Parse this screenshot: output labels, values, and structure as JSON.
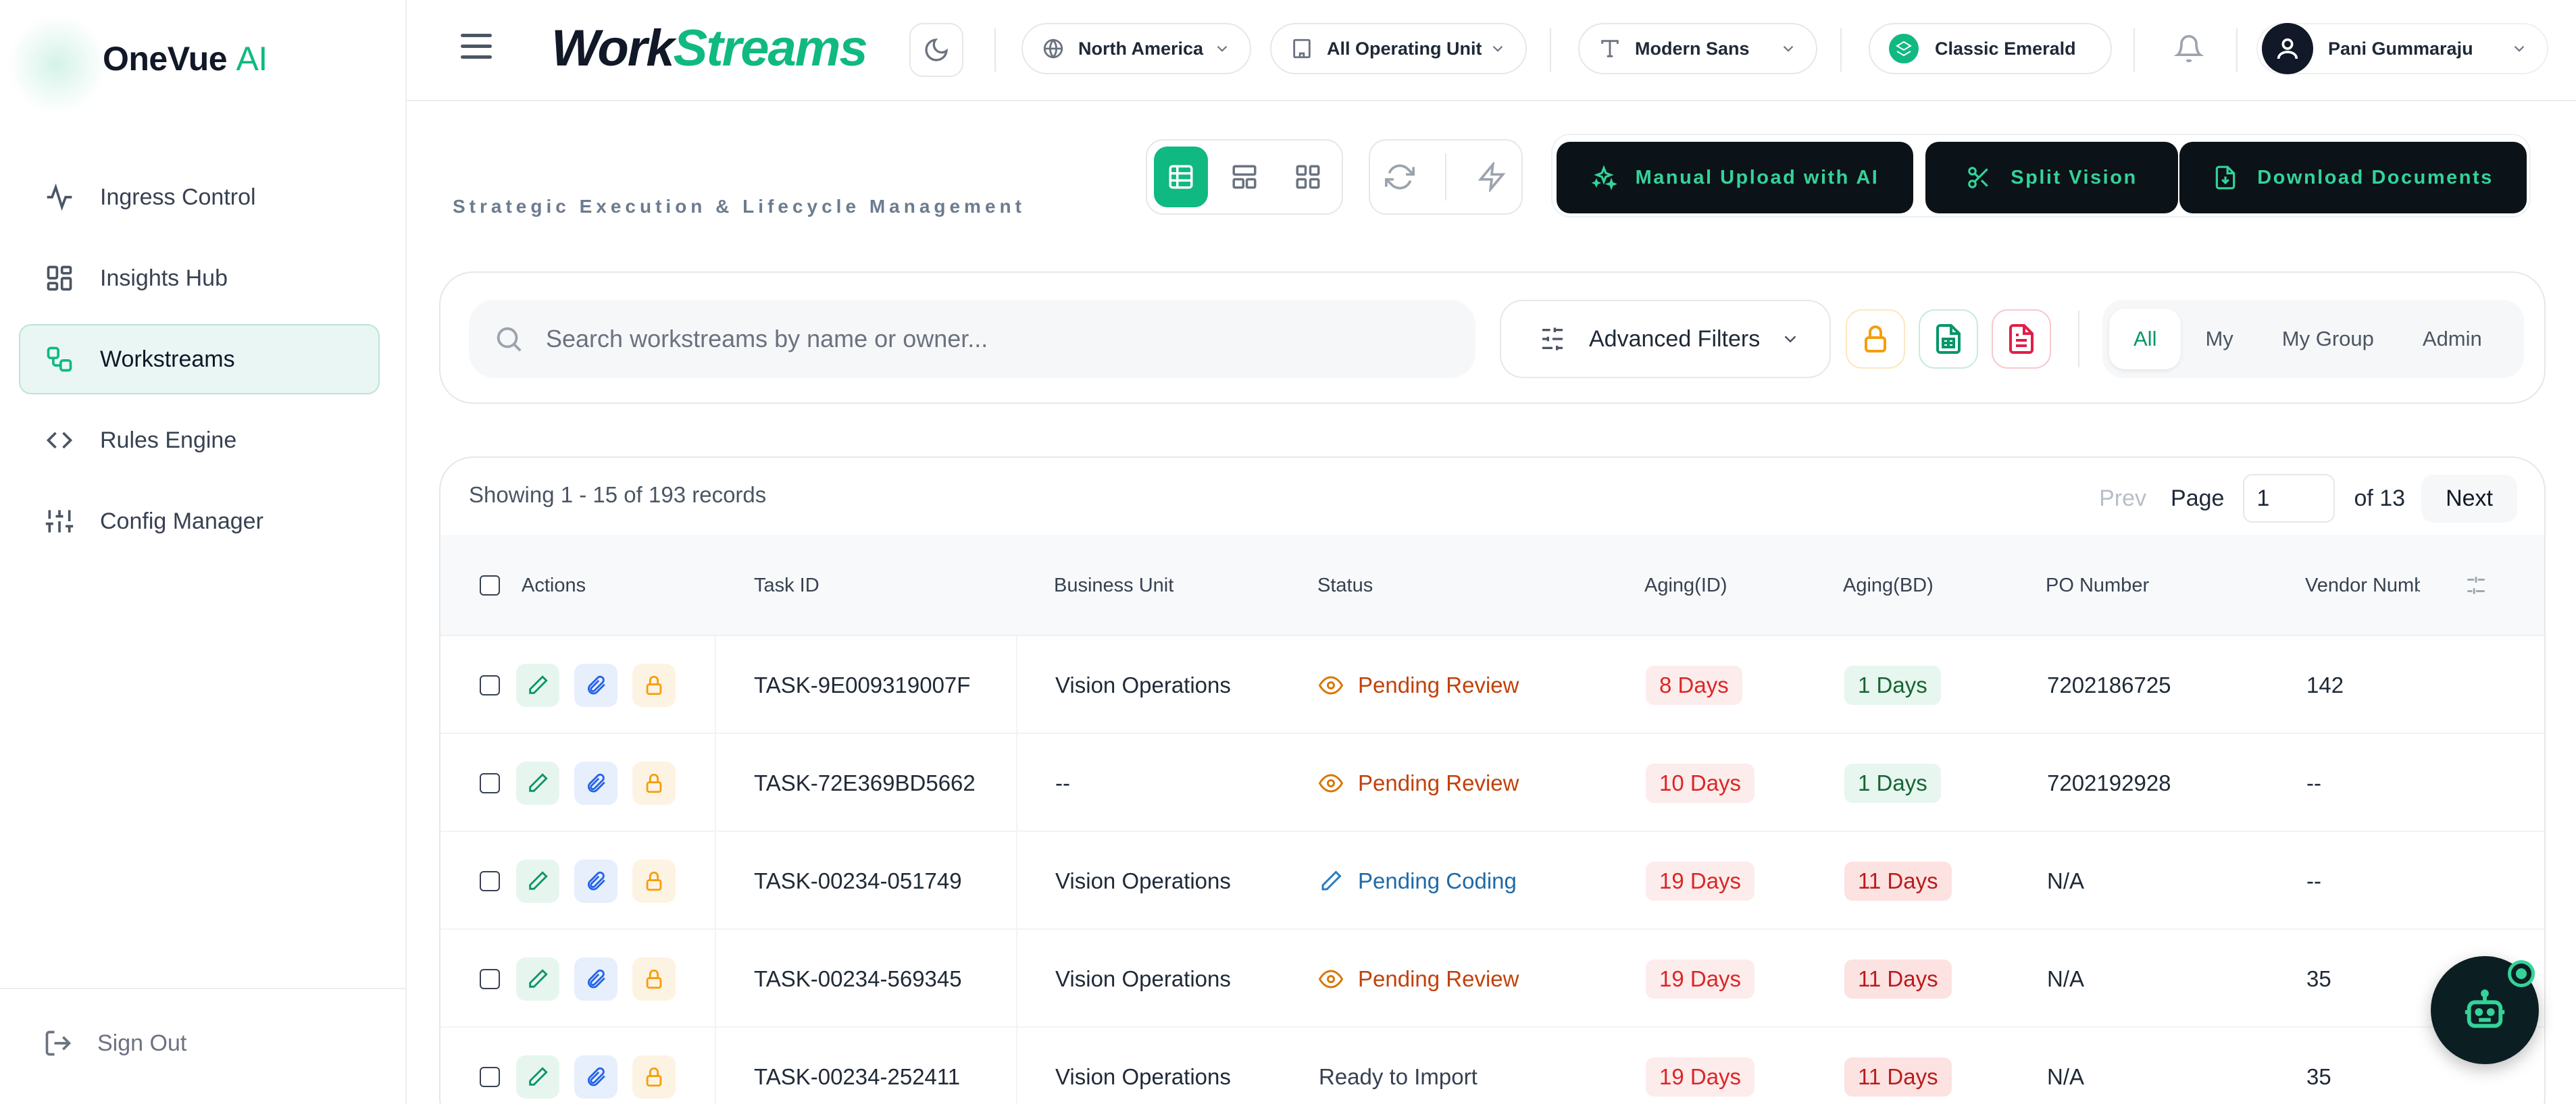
{
  "app": {
    "logo_main": "OneVue",
    "logo_ai": "AI"
  },
  "sidebar": {
    "items": [
      {
        "label": "Ingress Control",
        "icon": "activity-icon",
        "active": false
      },
      {
        "label": "Insights Hub",
        "icon": "dashboard-grid-icon",
        "active": false
      },
      {
        "label": "Workstreams",
        "icon": "workflow-icon",
        "active": true
      },
      {
        "label": "Rules Engine",
        "icon": "code-icon",
        "active": false
      },
      {
        "label": "Config Manager",
        "icon": "sliders-icon",
        "active": false
      }
    ],
    "signout_label": "Sign Out"
  },
  "header": {
    "brand_work": "Work",
    "brand_streams": "Streams",
    "region": "North America",
    "operating_unit": "All Operating Unit",
    "font": "Modern Sans",
    "theme": "Classic Emerald",
    "user_name": "Pani Gummaraju"
  },
  "page": {
    "subtitle": "Strategic Execution & Lifecycle Management",
    "actions": {
      "manual_upload": "Manual Upload with AI",
      "split_vision": "Split Vision",
      "download_documents": "Download Documents"
    }
  },
  "filters": {
    "search_placeholder": "Search workstreams by name or owner...",
    "advanced_label": "Advanced Filters",
    "scope": [
      "All",
      "My",
      "My Group",
      "Admin"
    ],
    "scope_selected": "All"
  },
  "table": {
    "showing": "Showing 1 - 15 of 193 records",
    "pager": {
      "prev": "Prev",
      "page_label": "Page",
      "page_value": "1",
      "of_label": "of 13",
      "next": "Next"
    },
    "columns": [
      "Actions",
      "Task ID",
      "Business Unit",
      "Status",
      "Aging(ID)",
      "Aging(BD)",
      "PO Number",
      "Vendor Numb"
    ],
    "rows": [
      {
        "task_id": "TASK-9E009319007F",
        "business_unit": "Vision Operations",
        "status": "Pending Review",
        "aging_id": "8 Days",
        "aging_bd": "1 Days",
        "po_number": "7202186725",
        "vendor": "142"
      },
      {
        "task_id": "TASK-72E369BD5662",
        "business_unit": "--",
        "status": "Pending Review",
        "aging_id": "10 Days",
        "aging_bd": "1 Days",
        "po_number": "7202192928",
        "vendor": "--"
      },
      {
        "task_id": "TASK-00234-051749",
        "business_unit": "Vision Operations",
        "status": "Pending Coding",
        "aging_id": "19 Days",
        "aging_bd": "11 Days",
        "po_number": "N/A",
        "vendor": "--"
      },
      {
        "task_id": "TASK-00234-569345",
        "business_unit": "Vision Operations",
        "status": "Pending Review",
        "aging_id": "19 Days",
        "aging_bd": "11 Days",
        "po_number": "N/A",
        "vendor": "35"
      },
      {
        "task_id": "TASK-00234-252411",
        "business_unit": "Vision Operations",
        "status": "Ready to Import",
        "aging_id": "19 Days",
        "aging_bd": "11 Days",
        "po_number": "N/A",
        "vendor": "35"
      }
    ]
  },
  "colors": {
    "accent": "#10b981",
    "dark": "#0b1218",
    "accent_text": "#34d399"
  }
}
